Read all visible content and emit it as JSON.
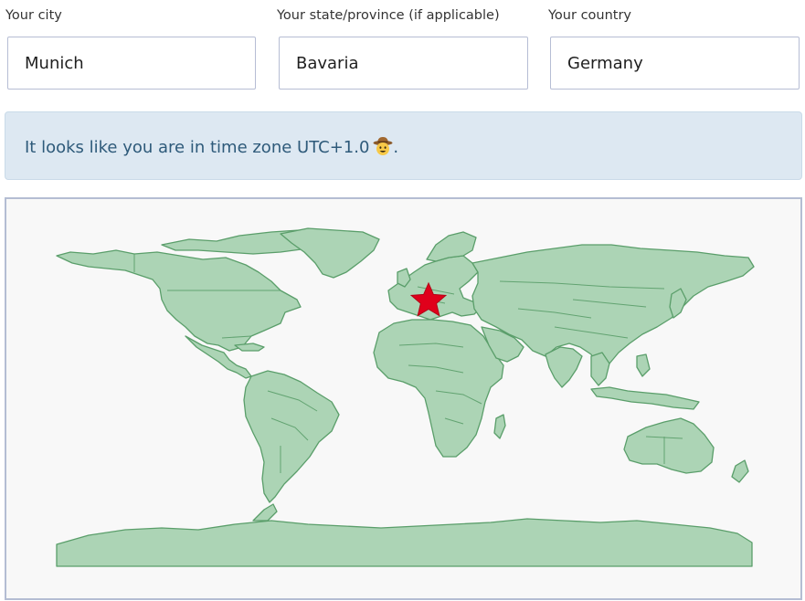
{
  "form": {
    "city": {
      "label": "Your city",
      "value": "Munich"
    },
    "state": {
      "label": "Your state/province (if applicable)",
      "value": "Bavaria"
    },
    "country": {
      "label": "Your country",
      "value": "Germany"
    }
  },
  "alert": {
    "text": "It looks like you are in time zone UTC+1.0",
    "emoji": "cowboy-hat-face-icon",
    "trailing": "."
  },
  "map": {
    "marker_icon": "star-icon",
    "marker_color": "#e0001b",
    "land_color": "#acd4b5",
    "border_color": "#5a9e6a",
    "background_color": "#f8f8f8"
  },
  "colors": {
    "alert_bg": "#dde8f2",
    "alert_text": "#2e5a7a",
    "input_border": "#b6bdd4"
  }
}
